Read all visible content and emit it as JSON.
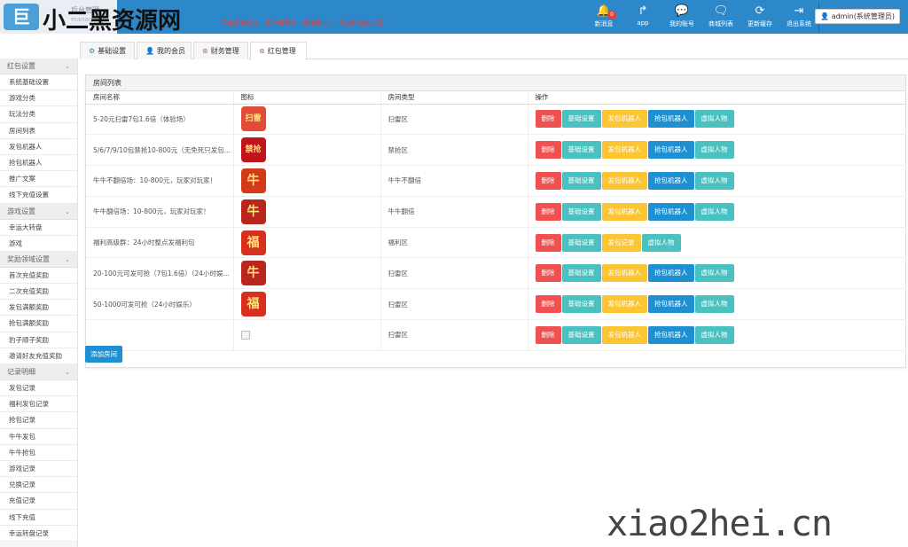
{
  "header": {
    "brand_badge": "巨",
    "brand_title": "小二黑资源网",
    "brand_sub": "后台管理",
    "brand_sub2": "manager",
    "notice": "平台开启状态：正常运营中，请谨慎进入一切操作会被记录！",
    "actions": [
      {
        "label": "新消息",
        "icon": "bell-icon",
        "glyph": "🔔",
        "badge": "0"
      },
      {
        "label": "app",
        "icon": "share-icon",
        "glyph": "↱"
      },
      {
        "label": "我的账号",
        "icon": "wechat-icon",
        "glyph": "💬"
      },
      {
        "label": "商城列表",
        "icon": "chat-icon",
        "glyph": "🗨"
      },
      {
        "label": "更新缓存",
        "icon": "refresh-icon",
        "glyph": "⟳"
      },
      {
        "label": "退出系统",
        "icon": "logout-icon",
        "glyph": "⇥"
      }
    ],
    "user": "admin(系统管理员)"
  },
  "tabs": [
    {
      "label": "基础设置",
      "icon": "gear-icon",
      "glyph": "⚙",
      "color": "#2c88c9"
    },
    {
      "label": "我的会员",
      "icon": "user-icon",
      "glyph": "👤",
      "color": "#5cb85c"
    },
    {
      "label": "财务管理",
      "icon": "money-icon",
      "glyph": "⊛",
      "color": "#d9534f"
    },
    {
      "label": "红包管理",
      "icon": "redpacket-icon",
      "glyph": "⊛",
      "color": "#d9534f"
    }
  ],
  "sidebar": {
    "sections": [
      {
        "title": "红包设置",
        "items": [
          "系统基础设置",
          "游戏分类",
          "玩法分类",
          "房间列表",
          "发包机器人",
          "抢包机器人",
          "推广文案",
          "线下充值设置"
        ]
      },
      {
        "title": "游戏设置",
        "items": [
          "幸运大转盘",
          "游戏"
        ]
      },
      {
        "title": "奖励领域设置",
        "items": [
          "首次充值奖励",
          "二次充值奖励",
          "发包满额奖励",
          "抢包满额奖励",
          "豹子顺子奖励",
          "邀请好友充值奖励"
        ]
      },
      {
        "title": "记录明细",
        "items": [
          "发包记录",
          "福利发包记录",
          "抢包记录",
          "牛牛发包",
          "牛牛抢包",
          "游戏记录",
          "兑换记录",
          "充值记录",
          "线下充值",
          "幸运转盘记录"
        ]
      }
    ]
  },
  "panel": {
    "title": "房间列表",
    "columns": [
      "房间名称",
      "图标",
      "房间类型",
      "操作"
    ],
    "rows": [
      {
        "name": "5-20元扫雷7包1.6倍（体验场）",
        "type": "扫雷区",
        "icon": "扫雷",
        "icon_bg": "#e24a3a",
        "buttons": [
          "删除",
          "基础设置",
          "发包机器人",
          "抢包机器人",
          "虚拟人物"
        ]
      },
      {
        "name": "5/6/7/9/10包禁抢10-800元（无免死只发包...",
        "type": "禁抢区",
        "icon": "禁抢",
        "icon_bg": "#c0141c",
        "buttons": [
          "删除",
          "基础设置",
          "发包机器人",
          "抢包机器人",
          "虚拟人物"
        ]
      },
      {
        "name": "牛牛不翻倍场：10-800元，玩家对玩家！",
        "type": "牛牛不翻倍",
        "icon": "牛",
        "icon_bg": "#d23a1a",
        "buttons": [
          "删除",
          "基础设置",
          "发包机器人",
          "抢包机器人",
          "虚拟人物"
        ]
      },
      {
        "name": "牛牛翻倍场：10-800元，玩家对玩家！",
        "type": "牛牛翻倍",
        "icon": "牛",
        "icon_bg": "#b8261e",
        "buttons": [
          "删除",
          "基础设置",
          "发包机器人",
          "抢包机器人",
          "虚拟人物"
        ]
      },
      {
        "name": "福利高级群：24小时整点发福利包",
        "type": "福利区",
        "icon": "福",
        "icon_bg": "#d8301e",
        "buttons": [
          "删除",
          "基础设置",
          "发包记录",
          "虚拟人物"
        ]
      },
      {
        "name": "20-100元可发可抢（7包1.6倍）（24小时娱...",
        "type": "扫雷区",
        "icon": "牛",
        "icon_bg": "#b8261e",
        "buttons": [
          "删除",
          "基础设置",
          "发包机器人",
          "抢包机器人",
          "虚拟人物"
        ]
      },
      {
        "name": "50-1000可发可抢（24小时娱乐）",
        "type": "扫雷区",
        "icon": "福",
        "icon_bg": "#d8301e",
        "buttons": [
          "删除",
          "基础设置",
          "发包机器人",
          "抢包机器人",
          "虚拟人物"
        ]
      },
      {
        "name": "",
        "type": "扫雷区",
        "icon": "",
        "icon_bg": "",
        "buttons": [
          "删除",
          "基础设置",
          "发包机器人",
          "抢包机器人",
          "虚拟人物"
        ]
      }
    ],
    "add_button": "添加房间"
  },
  "watermark": "xiao2hei.cn",
  "colors": {
    "header": "#2c88c9",
    "danger": "#f05050",
    "teal": "#4bc0c0",
    "warning": "#fbc533",
    "primary": "#1e8fd0"
  }
}
